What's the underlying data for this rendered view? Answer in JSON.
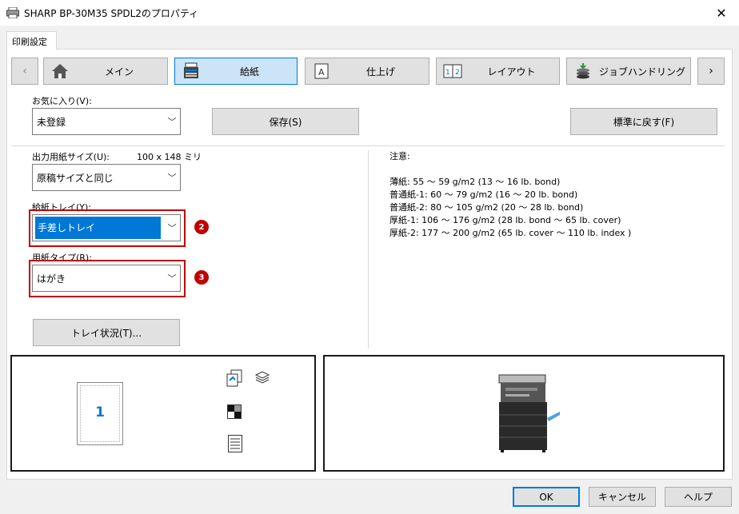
{
  "window": {
    "title": "SHARP BP-30M35 SPDL2のプロパティ"
  },
  "tabs": [
    {
      "label": "印刷設定"
    }
  ],
  "nav": {
    "prev": "‹",
    "next": "›",
    "items": [
      {
        "label": "メイン",
        "icon": "home-icon"
      },
      {
        "label": "給紙",
        "icon": "printer-paper-icon"
      },
      {
        "label": "仕上げ",
        "icon": "finishing-icon"
      },
      {
        "label": "レイアウト",
        "icon": "layout-icon"
      },
      {
        "label": "ジョブハンドリング",
        "icon": "job-handling-icon"
      }
    ]
  },
  "favorites": {
    "label": "お気に入り(V):",
    "value": "未登録",
    "save": "保存(S)",
    "reset": "標準に戻す(F)"
  },
  "output_size": {
    "label": "出力用紙サイズ(U):",
    "dimension": "100 x 148 ミリ",
    "value": "原稿サイズと同じ"
  },
  "tray": {
    "label": "給紙トレイ(Y):",
    "value": "手差しトレイ",
    "badge": "2"
  },
  "paper_type": {
    "label": "用紙タイプ(R):",
    "value": "はがき",
    "badge": "3"
  },
  "tray_status": "トレイ状況(T)...",
  "notes": {
    "title": "注意:",
    "lines": [
      "薄紙: 55 ～ 59 g/m2 (13 ～ 16 lb. bond)",
      "普通紙-1: 60 ～ 79 g/m2 (16 ～ 20 lb. bond)",
      "普通紙-2: 80 ～ 105 g/m2 (20 ～ 28 lb. bond)",
      "厚紙-1: 106 ～ 176 g/m2 (28 lb. bond ～ 65 lb. cover)",
      "厚紙-2: 177 ～ 200 g/m2 (65 lb. cover ～ 110 lb. index )"
    ]
  },
  "preview": {
    "page_number": "1"
  },
  "footer": {
    "ok": "OK",
    "cancel": "キャンセル",
    "help": "ヘルプ"
  },
  "colors": {
    "accent": "#0078d7",
    "selected_nav": "#cce4f7",
    "highlight_red": "#c00000"
  }
}
